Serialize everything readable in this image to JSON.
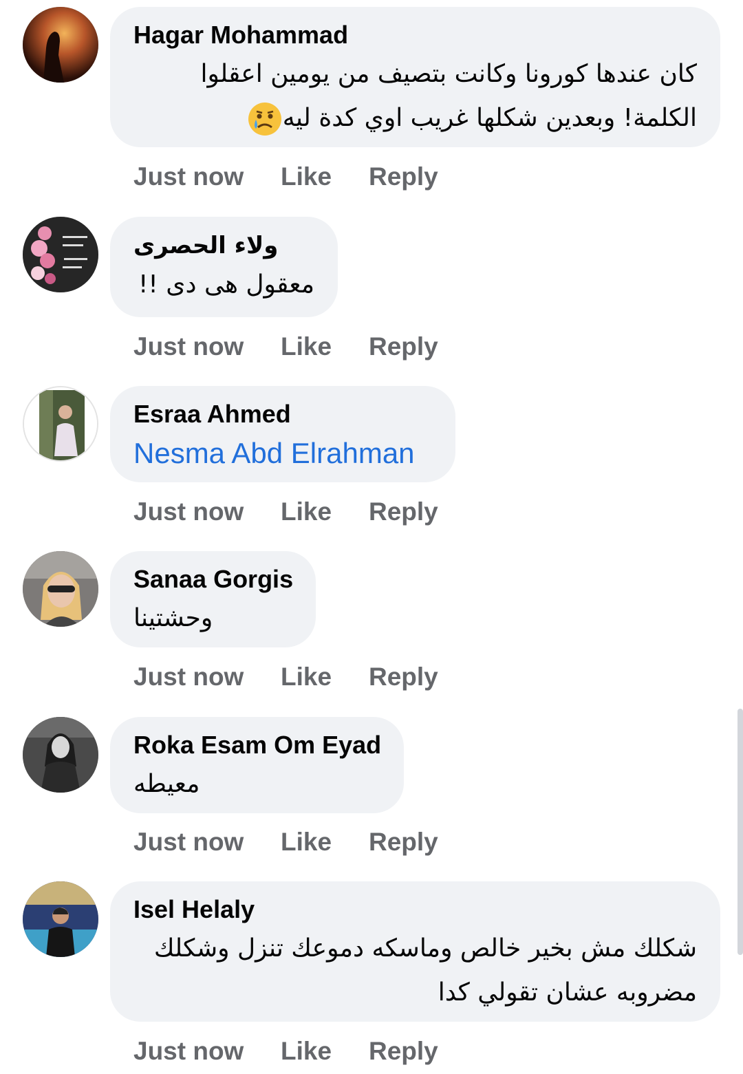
{
  "comments": [
    {
      "author": "Hagar Mohammad",
      "lines": [
        "كان عندها كورونا وكانت بتصيف من يومين اعقلوا",
        "الكلمة! وبعدين شكلها غريب اوي كدة ليه"
      ],
      "emoji": "crying-face-icon",
      "time": "Just now",
      "like": "Like",
      "reply": "Reply"
    },
    {
      "author": "ولاء الحصرى",
      "lines": [
        "معقول هى دى !!"
      ],
      "time": "Just now",
      "like": "Like",
      "reply": "Reply"
    },
    {
      "author": "Esraa Ahmed",
      "mention": "Nesma Abd Elrahman",
      "time": "Just now",
      "like": "Like",
      "reply": "Reply"
    },
    {
      "author": "Sanaa Gorgis",
      "lines": [
        "وحشتينا"
      ],
      "time": "Just now",
      "like": "Like",
      "reply": "Reply"
    },
    {
      "author": "Roka Esam Om Eyad",
      "lines": [
        "معيطه"
      ],
      "time": "Just now",
      "like": "Like",
      "reply": "Reply"
    },
    {
      "author": "Isel Helaly",
      "lines": [
        "شكلك مش بخير خالص وماسكه دموعك تنزل وشكلك",
        "مضروبه عشان تقولي كدا"
      ],
      "time": "Just now",
      "like": "Like",
      "reply": "Reply"
    }
  ],
  "colors": {
    "bubble": "#f0f2f5",
    "meta_text": "#65676b",
    "mention": "#216fdb",
    "text": "#050505"
  }
}
